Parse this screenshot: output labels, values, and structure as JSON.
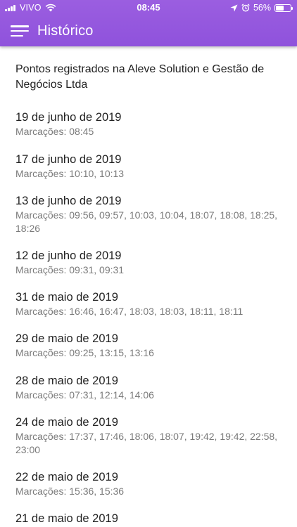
{
  "status_bar": {
    "carrier": "VIVO",
    "time": "08:45",
    "battery": "56%",
    "battery_level": 0.56
  },
  "header": {
    "title": "Histórico"
  },
  "company": "Pontos registrados na Aleve Solution e Gestão de Negócios Ltda",
  "entries": [
    {
      "date": "19 de junho de 2019",
      "marks": "Marcações: 08:45"
    },
    {
      "date": "17 de junho de 2019",
      "marks": "Marcações: 10:10, 10:13"
    },
    {
      "date": "13 de junho de 2019",
      "marks": "Marcações: 09:56, 09:57, 10:03, 10:04, 18:07, 18:08, 18:25, 18:26"
    },
    {
      "date": "12 de junho de 2019",
      "marks": "Marcações: 09:31, 09:31"
    },
    {
      "date": "31 de maio de 2019",
      "marks": "Marcações: 16:46, 16:47, 18:03, 18:03, 18:11, 18:11"
    },
    {
      "date": "29 de maio de 2019",
      "marks": "Marcações: 09:25, 13:15, 13:16"
    },
    {
      "date": "28 de maio de 2019",
      "marks": "Marcações: 07:31, 12:14, 14:06"
    },
    {
      "date": "24 de maio de 2019",
      "marks": "Marcações: 17:37, 17:46, 18:06, 18:07, 19:42, 19:42, 22:58, 23:00"
    },
    {
      "date": "22 de maio de 2019",
      "marks": "Marcações: 15:36, 15:36"
    },
    {
      "date": "21 de maio de 2019",
      "marks": ""
    }
  ]
}
